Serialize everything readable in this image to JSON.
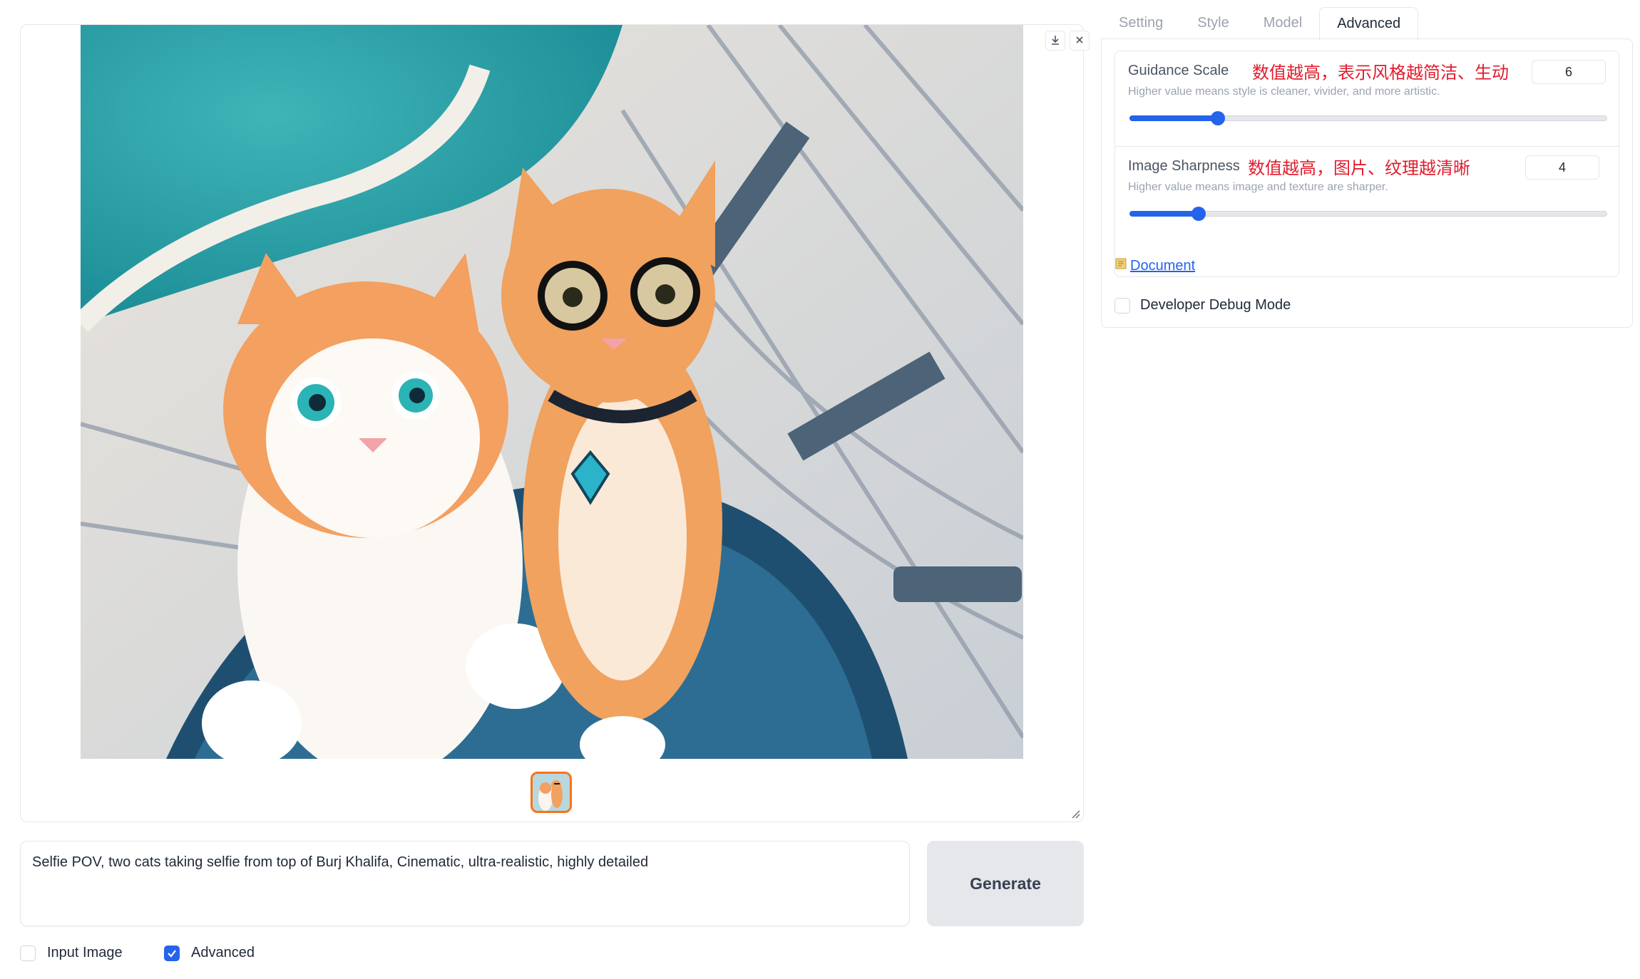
{
  "gallery": {
    "image_alt": "Two cats taking a selfie from the top of Burj Khalifa",
    "download_icon": "download-icon",
    "close_icon": "close-icon"
  },
  "prompt": {
    "value": "Selfie POV, two cats taking selfie from top of Burj Khalifa, Cinematic, ultra-realistic, highly detailed"
  },
  "generate_label": "Generate",
  "options": {
    "input_image_label": "Input Image",
    "input_image_checked": false,
    "advanced_label": "Advanced",
    "advanced_checked": true
  },
  "tabs": [
    "Setting",
    "Style",
    "Model",
    "Advanced"
  ],
  "active_tab": "Advanced",
  "guidance": {
    "label": "Guidance Scale",
    "note": "数值越高，表示风格越简洁、生动",
    "info": "Higher value means style is cleaner, vivider, and more artistic.",
    "value": "6",
    "slider_fraction": 0.185
  },
  "sharpness": {
    "label": "Image Sharpness",
    "note": "数值越高，图片、纹理越清晰",
    "info": "Higher value means image and texture are sharper.",
    "value": "4",
    "slider_fraction": 0.145
  },
  "document_link": "Document",
  "debug_label": "Developer Debug Mode",
  "colors": {
    "accent": "#2563eb",
    "thumb_border": "#f97316",
    "note": "#e11d2e"
  }
}
